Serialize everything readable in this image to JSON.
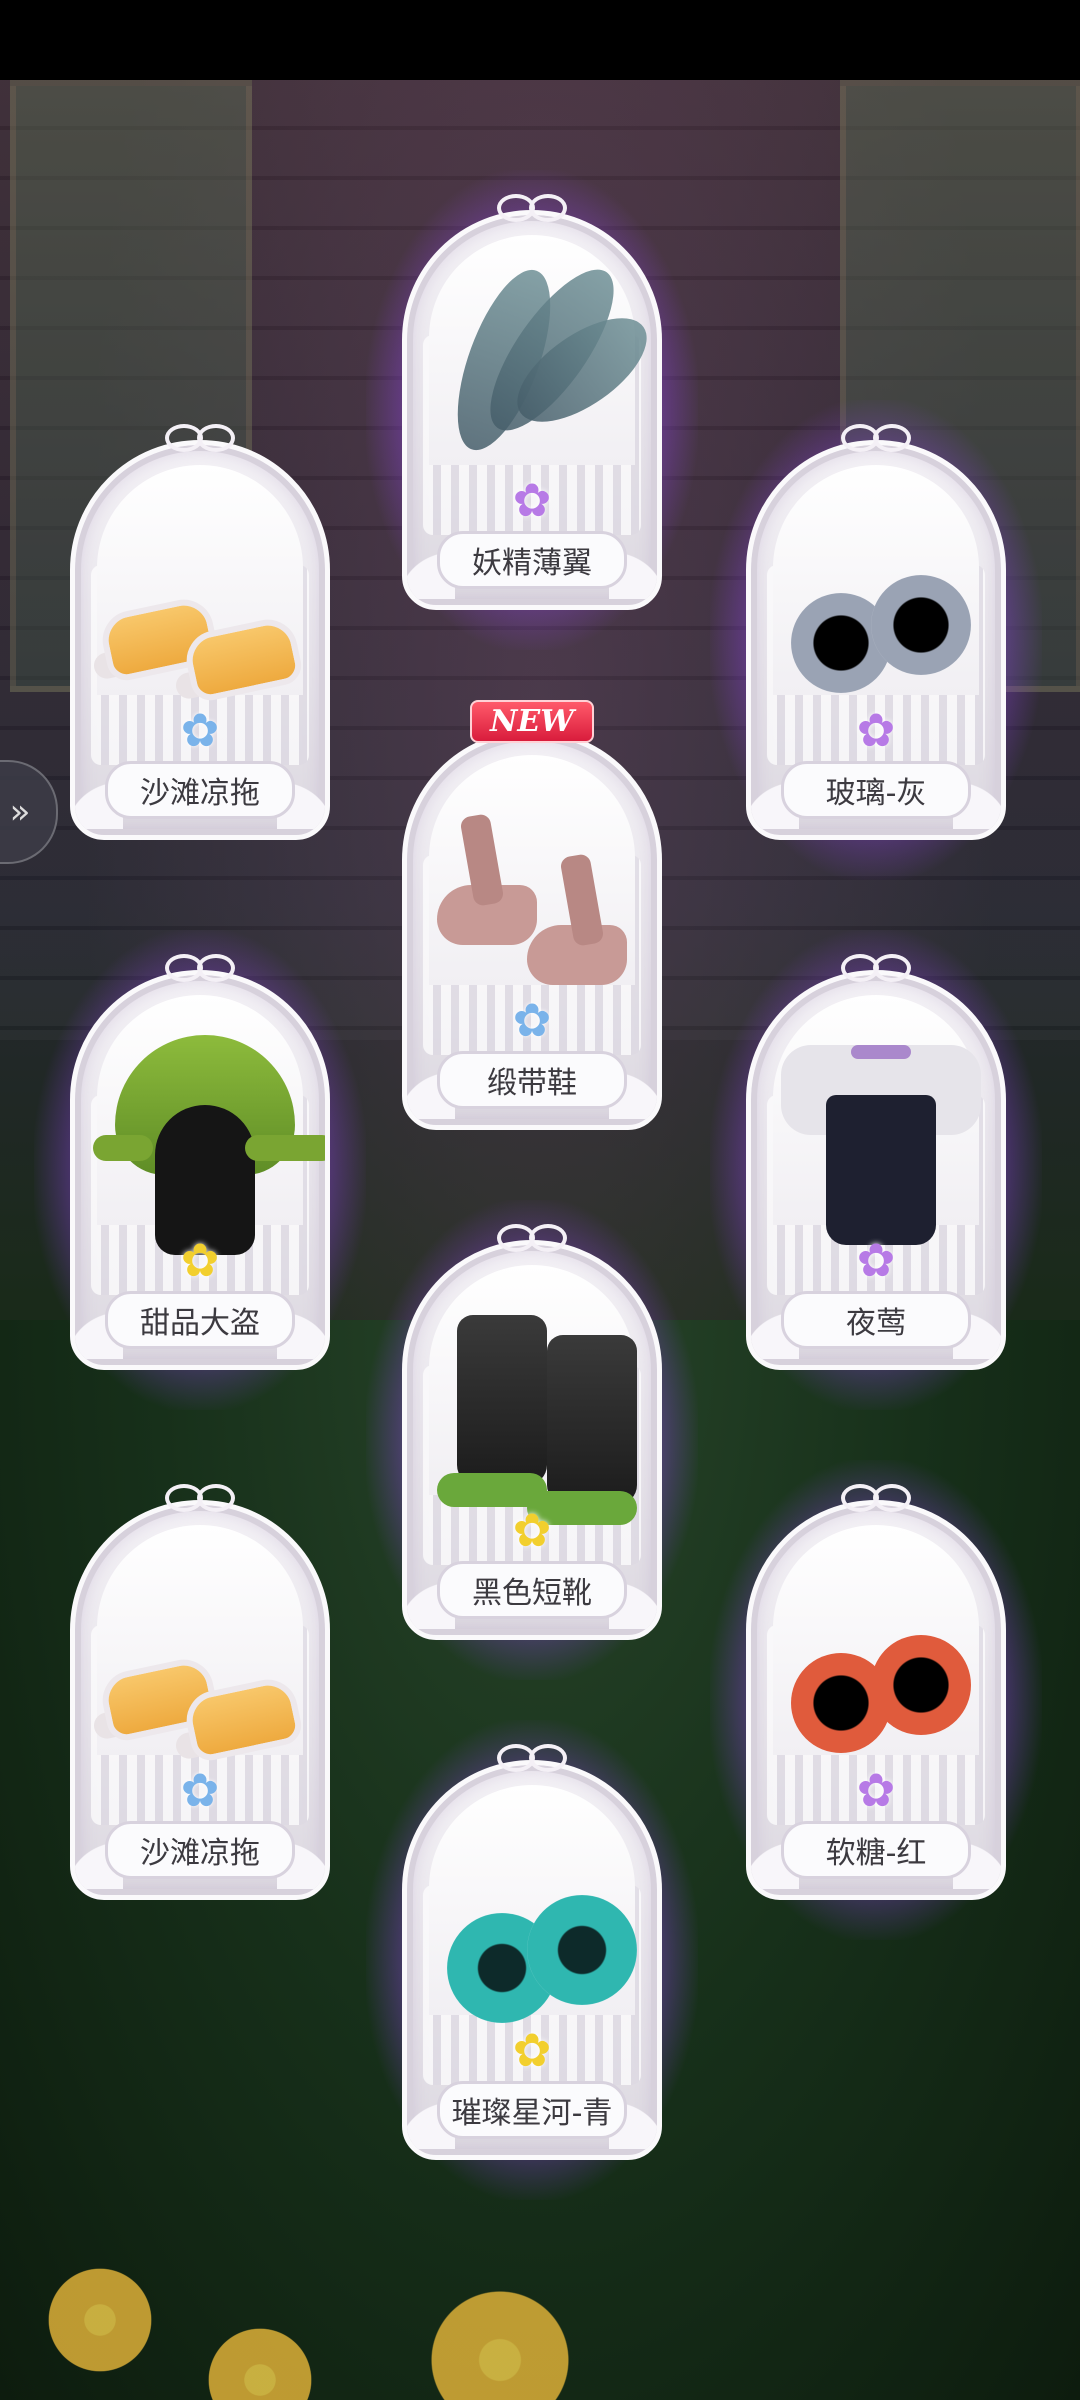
{
  "cards": {
    "wings": {
      "label": "妖精薄翼",
      "gem": "purple"
    },
    "slippers_1": {
      "label": "沙滩凉拖",
      "gem": "blue"
    },
    "glass_gray": {
      "label": "玻璃-灰",
      "gem": "purple"
    },
    "ribbon_shoes": {
      "label": "缎带鞋",
      "gem": "blue",
      "badge": "NEW"
    },
    "dessert_thief": {
      "label": "甜品大盗",
      "gem": "gold"
    },
    "nightingale": {
      "label": "夜莺",
      "gem": "purple"
    },
    "black_boots": {
      "label": "黑色短靴",
      "gem": "gold"
    },
    "slippers_2": {
      "label": "沙滩凉拖",
      "gem": "blue"
    },
    "candy_red": {
      "label": "软糖-红",
      "gem": "purple"
    },
    "galaxy_cyan": {
      "label": "璀璨星河-青",
      "gem": "gold"
    }
  },
  "colors": {
    "glow": "#a55cf0",
    "gem_blue": "#7ab3ea",
    "gem_purple": "#b77ae6",
    "gem_gold": "#f2cf2e",
    "new_badge": "#d91c3c"
  },
  "side_tab": {
    "icon": "chevron-right-icon"
  }
}
